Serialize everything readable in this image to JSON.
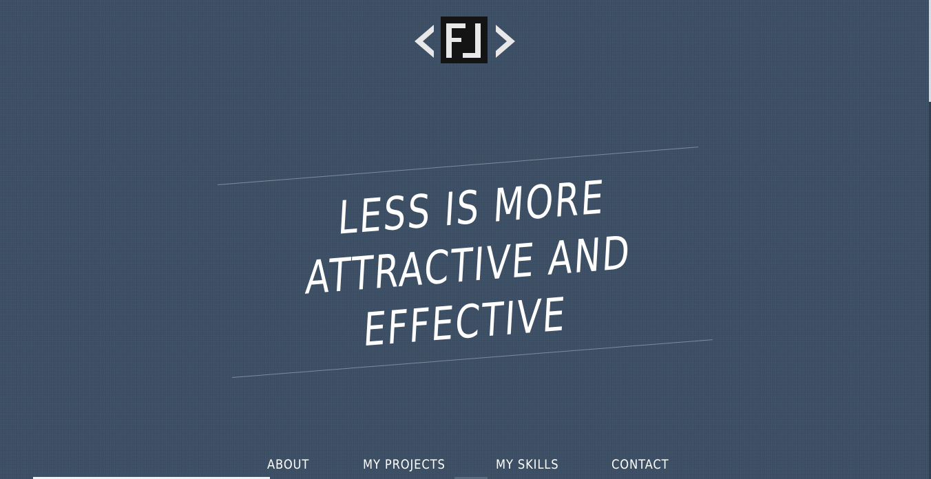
{
  "colors": {
    "background": "#3b4e63",
    "text": "#ffffff",
    "logo_dark": "#141414",
    "logo_light": "#e8e8e8"
  },
  "logo": {
    "letters": "FL",
    "icon": "code-brackets-logo"
  },
  "headline": {
    "line1": "LESS IS MORE",
    "line2": "ATTRACTIVE AND",
    "line3": "EFFECTIVE"
  },
  "nav": {
    "items": [
      {
        "label": "ABOUT"
      },
      {
        "label": "MY PROJECTS"
      },
      {
        "label": "MY SKILLS"
      },
      {
        "label": "CONTACT"
      }
    ]
  }
}
